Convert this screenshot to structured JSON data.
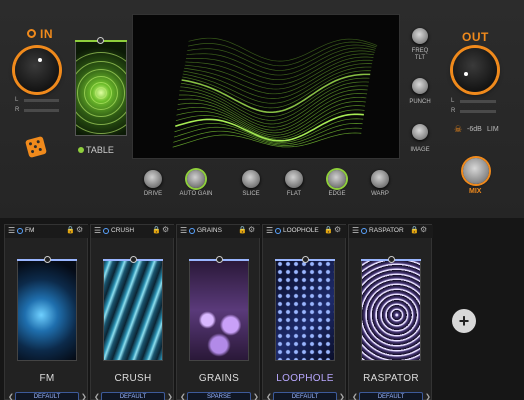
{
  "input": {
    "label": "IN",
    "meter_labels": [
      "L",
      "R"
    ]
  },
  "output": {
    "label": "OUT",
    "meter_labels": [
      "L",
      "R"
    ],
    "limit_text": "-6dB",
    "limit_label": "LIM",
    "mix_label": "MIX"
  },
  "table": {
    "label": "TABLE"
  },
  "side_controls": [
    "FREQ\nTLT",
    "PUNCH",
    "IMAGE"
  ],
  "knob_row": [
    "DRIVE",
    "AUTO GAIN",
    "SLICE",
    "FLAT",
    "EDGE",
    "WARP"
  ],
  "modules": [
    {
      "name": "FM",
      "title": "FM",
      "preset": "DEFAULT"
    },
    {
      "name": "CRUSH",
      "title": "CRUSH",
      "preset": "DEFAULT"
    },
    {
      "name": "GRAINS",
      "title": "GRAINS",
      "preset": "SPARSE"
    },
    {
      "name": "LOOPHOLE",
      "title": "LOOPHOLE",
      "preset": "DEFAULT"
    },
    {
      "name": "RASPATOR",
      "title": "RASPATOR",
      "preset": "DEFAULT"
    }
  ],
  "colors": {
    "accent": "#f08a1c",
    "wave": "#8fcf3c",
    "module_accent": "#9ab6ff"
  },
  "icons": {
    "add": "plus-icon",
    "random": "dice-icon",
    "menu": "hamburger-icon",
    "lock": "lock-icon",
    "settings": "gear-icon"
  }
}
